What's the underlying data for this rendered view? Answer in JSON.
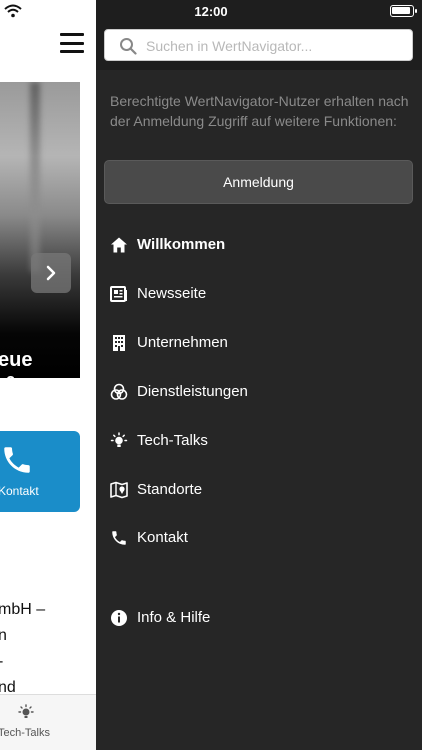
{
  "status_bar": {
    "time": "12:00"
  },
  "drawer": {
    "search_placeholder": "Suchen in WertNavigator...",
    "info_text": "Berechtigte WertNavigator-Nutzer erhalten nach der Anmeldung Zugriff auf weitere Funktionen:",
    "login_label": "Anmeldung",
    "menu": [
      {
        "label": "Willkommen",
        "icon": "home-icon"
      },
      {
        "label": "Newsseite",
        "icon": "newspaper-icon"
      },
      {
        "label": "Unternehmen",
        "icon": "building-icon"
      },
      {
        "label": "Dienstleistungen",
        "icon": "services-icon"
      },
      {
        "label": "Tech-Talks",
        "icon": "lightbulb-icon"
      },
      {
        "label": "Standorte",
        "icon": "map-icon"
      },
      {
        "label": "Kontakt",
        "icon": "phone-icon"
      },
      {
        "label": "Info & Hilfe",
        "icon": "info-icon"
      }
    ]
  },
  "background_page": {
    "hero_title": "eue\n &",
    "contact_tile_label": "Kontakt",
    "body_text": "mbH –\nn\n-\nnd",
    "bottom_tab_label": "Tech-Talks"
  }
}
